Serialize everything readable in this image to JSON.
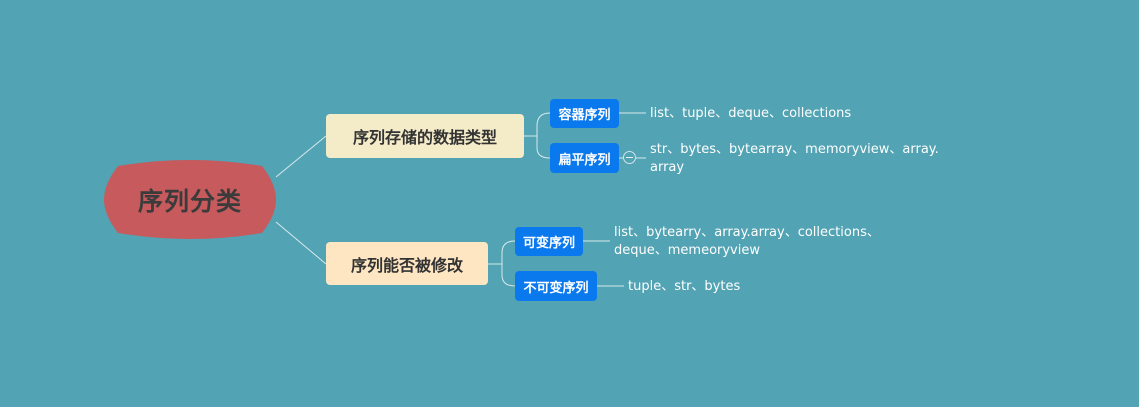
{
  "mindmap": {
    "root": {
      "label": "序列分类",
      "color": "#c65a5c"
    },
    "branches": [
      {
        "label": "序列存储的数据类型",
        "children": [
          {
            "label": "容器序列",
            "detail_lines": [
              "list、tuple、deque、collections"
            ]
          },
          {
            "label": "扁平序列",
            "detail_lines": [
              "str、bytes、bytearray、memoryview、array.",
              "array"
            ],
            "collapsible": true
          }
        ]
      },
      {
        "label": "序列能否被修改",
        "children": [
          {
            "label": "可变序列",
            "detail_lines": [
              "list、bytearry、array.array、collections、",
              "deque、memeoryview"
            ]
          },
          {
            "label": "不可变序列",
            "detail_lines": [
              "tuple、str、bytes"
            ]
          }
        ]
      }
    ]
  },
  "colors": {
    "background": "#52a3b3",
    "root_fill": "#c65a5c",
    "branch_fill": "#f4ebc8",
    "chip_fill": "#0a79ee",
    "line": "#d7eaee"
  }
}
